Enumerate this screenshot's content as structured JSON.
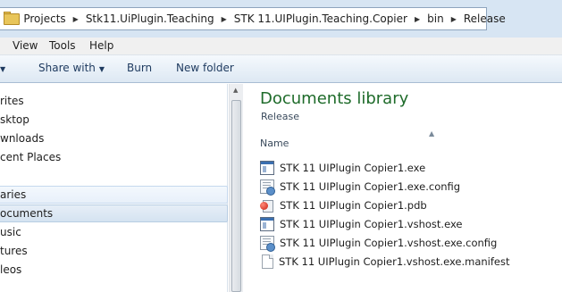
{
  "address_bar": {
    "overflow_chevron": "«",
    "breadcrumbs": [
      "Projects",
      "Stk11.UiPlugin.Teaching",
      "STK 11.UIPlugin.Teaching.Copier",
      "bin",
      "Release"
    ]
  },
  "menu": {
    "items": [
      "View",
      "Tools",
      "Help"
    ]
  },
  "toolbar": {
    "share_with": "Share with",
    "burn": "Burn",
    "new_folder": "New folder"
  },
  "nav_pane": {
    "items": [
      "rites",
      "sktop",
      "wnloads",
      "cent Places",
      "aries",
      "ocuments",
      "usic",
      "tures",
      "leos"
    ]
  },
  "main": {
    "library_title": "Documents library",
    "library_subtitle": "Release",
    "column_name": "Name",
    "files": [
      {
        "name": "STK 11 UIPlugin Copier1.exe",
        "icon": "exe-icon"
      },
      {
        "name": "STK 11 UIPlugin Copier1.exe.config",
        "icon": "config-icon"
      },
      {
        "name": "STK 11 UIPlugin Copier1.pdb",
        "icon": "pdb-icon"
      },
      {
        "name": "STK 11 UIPlugin Copier1.vshost.exe",
        "icon": "exe-icon"
      },
      {
        "name": "STK 11 UIPlugin Copier1.vshost.exe.config",
        "icon": "config-icon"
      },
      {
        "name": "STK 11 UIPlugin Copier1.vshost.exe.manifest",
        "icon": "file-icon"
      }
    ]
  },
  "colors": {
    "library_title": "#1e6b2a",
    "toolbar_text": "#1e3a5f",
    "chrome_bg": "#d7e5f3"
  }
}
